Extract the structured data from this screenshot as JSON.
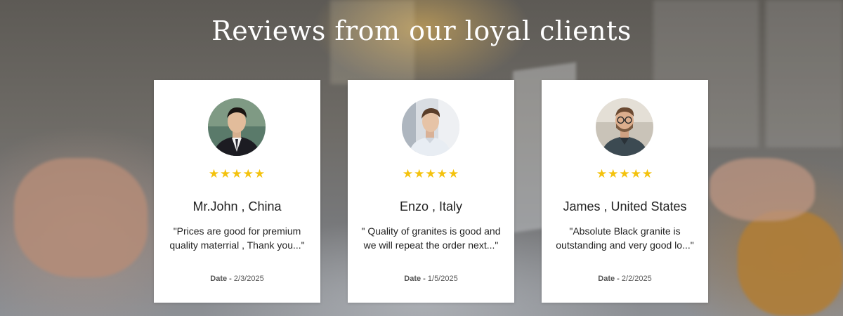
{
  "section": {
    "title": "Reviews from our loyal clients"
  },
  "reviews": [
    {
      "name": "Mr.John , China",
      "quote": "\"Prices are good for premium quality materrial , Thank you...\"",
      "rating_stars": "★★★★★",
      "rating": 5,
      "date_label": "Date -",
      "date_value": "2/3/2025",
      "avatar_icon": "person-suit-avatar"
    },
    {
      "name": "Enzo , Italy",
      "quote": "\" Quality of granites is good and we will repeat the order next...\"",
      "rating_stars": "★★★★★",
      "rating": 5,
      "date_label": "Date -",
      "date_value": "1/5/2025",
      "avatar_icon": "person-shirt-avatar"
    },
    {
      "name": "James , United States",
      "quote": "\"Absolute Black granite is outstanding and very good lo...\"",
      "rating_stars": "★★★★★",
      "rating": 5,
      "date_label": "Date -",
      "date_value": "2/2/2025",
      "avatar_icon": "person-glasses-avatar"
    }
  ],
  "colors": {
    "star": "#f4c20d",
    "card_bg": "#ffffff",
    "title_text": "#ffffff",
    "body_text": "#222222"
  }
}
